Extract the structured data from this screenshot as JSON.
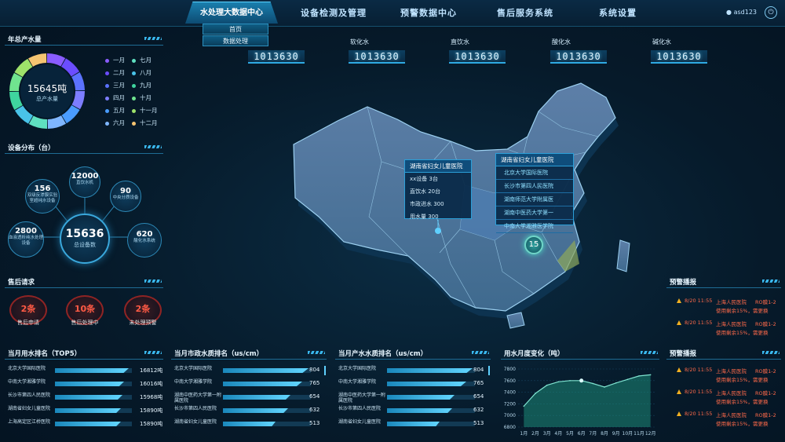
{
  "nav": {
    "active": "水处理大数据中心",
    "items": [
      "设备检测及管理",
      "预警数据中心",
      "售后服务系统",
      "系统设置"
    ],
    "submenu": [
      "首页",
      "数据处理"
    ],
    "user": "asd123"
  },
  "totals": {
    "items": [
      {
        "label": "",
        "value": "1013630"
      },
      {
        "label": "软化水",
        "value": "1013630"
      },
      {
        "label": "直饮水",
        "value": "1013630"
      },
      {
        "label": "酸化水",
        "value": "1013630"
      },
      {
        "label": "碱化水",
        "value": "1013630"
      }
    ]
  },
  "annual": {
    "title": "年总产水量",
    "total": "15645吨",
    "sub": "总产水量",
    "months": [
      {
        "name": "一月",
        "color": "#8a5cff"
      },
      {
        "name": "七月",
        "color": "#5fe0c0"
      },
      {
        "name": "二月",
        "color": "#6b4dff"
      },
      {
        "name": "八月",
        "color": "#49c3e8"
      },
      {
        "name": "三月",
        "color": "#5b72ff"
      },
      {
        "name": "九月",
        "color": "#3fd59e"
      },
      {
        "name": "四月",
        "color": "#7d7dff"
      },
      {
        "name": "十月",
        "color": "#70e48f"
      },
      {
        "name": "五月",
        "color": "#4a9cff"
      },
      {
        "name": "十一月",
        "color": "#9ee26a"
      },
      {
        "name": "六月",
        "color": "#7fb6ff"
      },
      {
        "name": "十二月",
        "color": "#f5c471"
      }
    ]
  },
  "devices": {
    "title": "设备分布（台）",
    "total": "15636",
    "total_label": "总设备数",
    "bubbles": [
      {
        "num": "12000",
        "lbl": "直饮水机"
      },
      {
        "num": "156",
        "lbl": "双级反渗膜实验室超纯水设备"
      },
      {
        "num": "90",
        "lbl": "中央分质设备"
      },
      {
        "num": "2800",
        "lbl": "血液透析纯水处理设备"
      },
      {
        "num": "620",
        "lbl": "酸化水系统"
      }
    ]
  },
  "aftersales": {
    "title": "售后请求",
    "items": [
      {
        "num": "2条",
        "label": "售后申请"
      },
      {
        "num": "10条",
        "label": "售后处理中"
      },
      {
        "num": "2条",
        "label": "未处理预警"
      }
    ]
  },
  "map": {
    "popup1": {
      "title": "湖南省妇女儿童医院",
      "lines": [
        "xx设备   3台",
        "直饮水  20台",
        "市政进水  300",
        "用水量  300"
      ]
    },
    "popup2": {
      "title": "湖南省妇女儿童医院",
      "hospitals": [
        "北京大学国际医院",
        "长沙市第四人民医院",
        "湖南师范大学附属医",
        "湖南中医药大学第一",
        "中南大学湘雅医学院"
      ]
    },
    "badge": "15"
  },
  "rank1": {
    "title": "当月用水排名（TOP5）",
    "rows": [
      {
        "name": "北京大学国际医院",
        "value": "16812吨",
        "pct": 0.96
      },
      {
        "name": "中南大学湘雅学院",
        "value": "16016吨",
        "pct": 0.9
      },
      {
        "name": "长沙市第四人民医院",
        "value": "15968吨",
        "pct": 0.88
      },
      {
        "name": "湖南省妇女儿童医院",
        "value": "15890吨",
        "pct": 0.86
      },
      {
        "name": "上海高定区江桥医院",
        "value": "15890吨",
        "pct": 0.86
      }
    ]
  },
  "rank2": {
    "title": "当月市政水质排名（us/cm）",
    "rows": [
      {
        "name": "北京大学国际医院",
        "value": "804",
        "pct": 0.97
      },
      {
        "name": "中南大学湘雅学院",
        "value": "765",
        "pct": 0.9
      },
      {
        "name": "湖南中医药大学第一附属医院",
        "value": "654",
        "pct": 0.77
      },
      {
        "name": "长沙市第四人民医院",
        "value": "632",
        "pct": 0.74
      },
      {
        "name": "湖南省妇女儿童医院",
        "value": "513",
        "pct": 0.6
      }
    ]
  },
  "rank3": {
    "title": "当月产水水质排名（us/cm）",
    "rows": [
      {
        "name": "北京大学国际医院",
        "value": "804",
        "pct": 0.97
      },
      {
        "name": "中南大学湘雅学院",
        "value": "765",
        "pct": 0.9
      },
      {
        "name": "湖南中医药大学第一附属医院",
        "value": "654",
        "pct": 0.77
      },
      {
        "name": "长沙市第四人民医院",
        "value": "632",
        "pct": 0.74
      },
      {
        "name": "湖南省妇女儿童医院",
        "value": "513",
        "pct": 0.6
      }
    ]
  },
  "warn1": {
    "title": "预警播报",
    "rows": [
      {
        "time": "8/20 11:55",
        "org": "上海人民医院",
        "dev": "RO膜1-2",
        "msg": "使用剩余15%，需更换"
      },
      {
        "time": "8/20 11:55",
        "org": "上海人民医院",
        "dev": "RO膜1-2",
        "msg": "使用剩余15%，需更换"
      }
    ]
  },
  "warn2": {
    "title": "预警播报",
    "rows": [
      {
        "time": "8/20 11:55",
        "org": "上海人民医院",
        "dev": "RO膜1-2",
        "msg": "使用剩余15%，需更换"
      },
      {
        "time": "8/20 11:55",
        "org": "上海人民医院",
        "dev": "RO膜1-2",
        "msg": "使用剩余15%，需更换"
      },
      {
        "time": "8/20 11:55",
        "org": "上海人民医院",
        "dev": "RO膜1-2",
        "msg": "使用剩余15%，需更换"
      }
    ]
  },
  "chart_data": {
    "type": "area",
    "title": "用水月度变化（吨）",
    "categories": [
      "1月",
      "2月",
      "3月",
      "4月",
      "5月",
      "6月",
      "7月",
      "8月",
      "9月",
      "10月",
      "11月",
      "12月"
    ],
    "values": [
      7160,
      7380,
      7520,
      7580,
      7600,
      7600,
      7550,
      7490,
      7560,
      7620,
      7680,
      7700
    ],
    "ylim": [
      6800,
      7800
    ],
    "yticks": [
      "7800",
      "7600",
      "7400",
      "7200",
      "7000",
      "6800"
    ],
    "highlight_index": 5,
    "colors": {
      "line": "#7fe3d0",
      "fill": "#1d8a78"
    }
  }
}
